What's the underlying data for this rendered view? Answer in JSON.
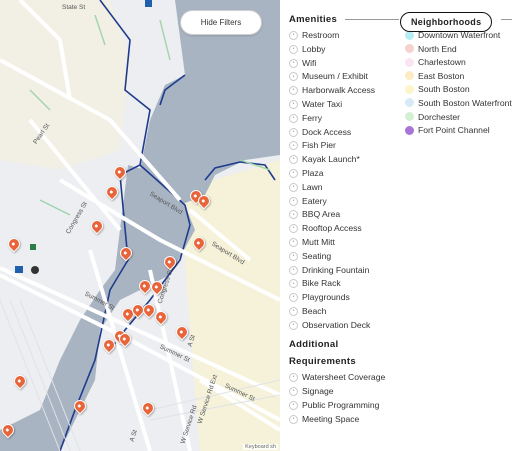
{
  "map": {
    "hide_filters_label": "Hide Filters",
    "keyboard_hint": "Keyboard sh",
    "streets": [
      "State St",
      "Pearl St",
      "Congress St",
      "Seaport Blvd",
      "Seaport Blvd",
      "Summer St",
      "Congress St",
      "Summer St",
      "A St",
      "Summer St",
      "W Service Rd Ext",
      "A St",
      "W Service Rd"
    ]
  },
  "amenities": {
    "title": "Amenities",
    "items": [
      {
        "label": "Restroom",
        "icon": "restroom-icon"
      },
      {
        "label": "Lobby",
        "icon": "lobby-icon"
      },
      {
        "label": "Wifi",
        "icon": "wifi-icon"
      },
      {
        "label": "Museum / Exhibit",
        "icon": "museum-icon"
      },
      {
        "label": "Harborwalk Access",
        "icon": "harborwalk-icon"
      },
      {
        "label": "Water Taxi",
        "icon": "water-taxi-icon"
      },
      {
        "label": "Ferry",
        "icon": "ferry-icon"
      },
      {
        "label": "Dock Access",
        "icon": "dock-icon"
      },
      {
        "label": "Fish Pier",
        "icon": "fish-icon"
      },
      {
        "label": "Kayak Launch*",
        "icon": "kayak-icon"
      },
      {
        "label": "Plaza",
        "icon": "plaza-icon"
      },
      {
        "label": "Lawn",
        "icon": "lawn-icon"
      },
      {
        "label": "Eatery",
        "icon": "eatery-icon"
      },
      {
        "label": "BBQ Area",
        "icon": "bbq-icon"
      },
      {
        "label": "Rooftop Access",
        "icon": "rooftop-icon"
      },
      {
        "label": "Mutt Mitt",
        "icon": "mutt-mitt-icon"
      },
      {
        "label": "Seating",
        "icon": "seating-icon"
      },
      {
        "label": "Drinking Fountain",
        "icon": "fountain-icon"
      },
      {
        "label": "Bike Rack",
        "icon": "bike-icon"
      },
      {
        "label": "Playgrounds",
        "icon": "playground-icon"
      },
      {
        "label": "Beach",
        "icon": "beach-icon"
      },
      {
        "label": "Observation Deck",
        "icon": "binoculars-icon"
      }
    ]
  },
  "additional": {
    "title_line1": "Additional",
    "title_line2": "Requirements",
    "items": [
      {
        "label": "Watersheet Coverage",
        "icon": "watersheet-icon"
      },
      {
        "label": "Signage",
        "icon": "signage-icon"
      },
      {
        "label": "Public Programming",
        "icon": "programming-icon"
      },
      {
        "label": "Meeting Space",
        "icon": "meeting-icon"
      }
    ]
  },
  "neighborhoods": {
    "title": "Neighborhoods",
    "items": [
      {
        "label": "Downtown Waterfront",
        "color": "#b8eef2"
      },
      {
        "label": "North End",
        "color": "#f7d0d0"
      },
      {
        "label": "Charlestown",
        "color": "#fbe4f2"
      },
      {
        "label": "East Boston",
        "color": "#fbecc4"
      },
      {
        "label": "South Boston",
        "color": "#fdf4c9"
      },
      {
        "label": "South Boston Waterfront",
        "color": "#d9eaf7"
      },
      {
        "label": "Dorchester",
        "color": "#d4efd2"
      },
      {
        "label": "Fort Point Channel",
        "color": "#a875d6"
      }
    ]
  },
  "colors": {
    "pin": "#e8643a",
    "water": "#a9b4c3",
    "boundary": "#1f3b8c"
  }
}
